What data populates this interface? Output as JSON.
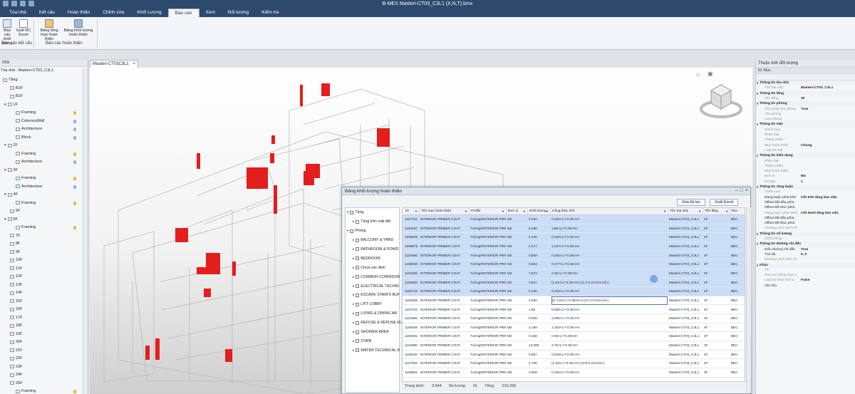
{
  "window": {
    "title": "B-MEX Masteri-CT03_C3L1 (X,N,T).bmx"
  },
  "ribbon_tabs": [
    "Tòa nhà",
    "Kết cấu",
    "Hoàn thiện",
    "Chỉnh sửa",
    "Khối Lượng",
    "Báo cáo",
    "Xem",
    "Đối tượng",
    "Kiểm tra"
  ],
  "ribbon_active": "Báo cáo",
  "ribbon": {
    "btn1": "Báo cáo khối lượng",
    "btn2": "Xuất RC Excel",
    "group1": "Báo cáo kết cấu",
    "btn3": "Bảng tổng hợp hoàn thiện",
    "btn4": "Bảng khối lượng hoàn thiện",
    "group2": "Báo cáo hoàn thiện"
  },
  "left_panel": {
    "header": "nhà",
    "root": "Tòa nhà : Masteri-CT03_C3L1",
    "items": [
      "Tầng",
      "B2F",
      "B1F",
      "1F",
      "Framing",
      "ColumnsWall",
      "Architecture",
      "Block",
      "2F",
      "Framing",
      "Architecture",
      "3F",
      "Framing",
      "Architecture",
      "4F",
      "Framing",
      "5F",
      "6F",
      "Framing",
      "7F",
      "8F",
      "9F",
      "10F",
      "11F",
      "12F",
      "13F",
      "14F",
      "15F",
      "16F",
      "17F",
      "18F",
      "19F",
      "20F",
      "21F",
      "22F",
      "23F",
      "24F",
      "25F",
      "Framing"
    ]
  },
  "view_tab": "Masteri-CT03C3L1",
  "dialog": {
    "title": "Bảng khối lượng hoàn thiện",
    "btn_clear": "Xóa bộ lọc",
    "btn_export": "Xuất Excel",
    "filters": [
      "Tầng",
      "Tầng trên mặt đất",
      "Phòng",
      "BALCONY & YARD",
      "BATHROOM & POWD",
      "BEDROOM",
      "Chưa xác định",
      "COMMON CORRIDOR",
      "ELECTRICAL TECHNI",
      "ESCAPE STAIR'S BUF",
      "LIFT LOBBY",
      "LIVING & DINING AR",
      "REFUSE & REPUSE EL",
      "SHOWER AREA",
      "STAIR",
      "WATER TECHNICAL R"
    ],
    "columns": [
      "ID",
      "Tên mục hoàn thiện",
      "Profile",
      "Đơn vị",
      "Khối lượng",
      "Công thức tính",
      "Tên tòa nhà",
      "Tên tầng",
      "Bec"
    ],
    "rows": [
      [
        "1107721",
        "INTERIOR PRIMER COAT",
        "Tường#INTERIOR PRIMER C",
        "M2",
        "0.342",
        "0.182<L>*3.35<H>",
        "Masteri-CT03_C3L1",
        "4F",
        "BEC"
      ],
      [
        "1103497",
        "INTERIOR PRIMER COAT",
        "Tường#INTERIOR PRIMER C",
        "M2",
        "6.198",
        "1.85<L>*3.35<H>",
        "Masteri-CT03_C3L1",
        "4F",
        "BEC"
      ],
      [
        "1099930",
        "INTERIOR PRIMER COAT",
        "Tường#INTERIOR PRIMER C",
        "M2",
        "0.345",
        "0.183<L>*3.35<H>",
        "Masteri-CT03_C3L1",
        "4F",
        "BEC"
      ],
      [
        "1099875",
        "INTERIOR PRIMER COAT",
        "Tường#INTERIOR PRIMER C",
        "M2",
        "4.177",
        "1.247<L>*3.35<H>",
        "Masteri-CT03_C3L1",
        "4F",
        "BEC"
      ],
      [
        "1102966",
        "INTERIOR PRIMER COAT",
        "Tường#INTERIOR PRIMER C",
        "M2",
        "0.509",
        "0.152<L>*3.35<H>",
        "Masteri-CT03_C3L1",
        "4F",
        "BEC"
      ],
      [
        "1108049",
        "INTERIOR PRIMER COAT",
        "Tường#INTERIOR PRIMER C",
        "M2",
        "0.593",
        "0.177<L>*3.35<H>",
        "Masteri-CT03_C3L1",
        "4F",
        "BEC"
      ],
      [
        "1101506",
        "INTERIOR PRIMER COAT",
        "Tường#INTERIOR PRIMER C",
        "M2",
        "7.873",
        "2.35<L>*3.35<H>",
        "Masteri-CT03_C3L1",
        "4F",
        "BEC"
      ],
      [
        "1106820",
        "INTERIOR PRIMER COAT",
        "Tường#INTERIOR PRIMER C",
        "M2",
        "3.647",
        "(1.81<L>*3.35<H>)-(1.1*2.2<Cửa sổ>)",
        "Masteri-CT03_C3L1",
        "4F",
        "BEC"
      ],
      [
        "1106718",
        "INTERIOR PRIMER COAT",
        "Tường#INTERIOR PRIMER C",
        "M2",
        "0.345",
        "0.183<L>*3.35<H>",
        "Masteri-CT03_C3L1",
        "4F",
        "BEC"
      ],
      [
        "1106208",
        "INTERIOR PRIMER COAT",
        "Tường#INTERIOR PRIMER C",
        "M2",
        "4.692",
        "(2.714<L>*3.35<H>)-(2*2.2<Cửa sổ>)",
        "Masteri-CT03_C3L1",
        "4F",
        "BEC"
      ],
      [
        "1107243",
        "INTERIOR PRIMER COAT",
        "Tường#INTERIOR PRIMER C",
        "M2",
        "1.96",
        "0.585<L>*3.35<H>",
        "Masteri-CT03_C3L1",
        "4F",
        "BEC"
      ],
      [
        "1111968",
        "INTERIOR PRIMER COAT",
        "Tường#INTERIOR PRIMER C",
        "M2",
        "9.028",
        "2.695<L>*3.35<H>",
        "Masteri-CT03_C3L1",
        "4F",
        "BEC"
      ],
      [
        "1106459",
        "INTERIOR PRIMER COAT",
        "Tường#INTERIOR PRIMER C",
        "M2",
        "4.199",
        "1.253<L>*3.35<H>",
        "Masteri-CT03_C3L1",
        "4F",
        "BEC"
      ],
      [
        "1102031",
        "INTERIOR PRIMER COAT",
        "Tường#INTERIOR PRIMER C",
        "M2",
        "0.168",
        "0.05<L>*3.35<H>",
        "Masteri-CT03_C3L1",
        "4F",
        "BEC"
      ],
      [
        "1102690",
        "INTERIOR PRIMER COAT",
        "Tường#INTERIOR PRIMER C",
        "M2",
        "12.596",
        "3.76<L>*3.35<H>",
        "Masteri-CT03_C3L1",
        "4F",
        "BEC"
      ],
      [
        "1106220",
        "INTERIOR PRIMER COAT",
        "Tường#INTERIOR PRIMER C",
        "M2",
        "0.697",
        "0.208<L>*3.35<H>",
        "Masteri-CT03_C3L1",
        "4F",
        "BEC"
      ],
      [
        "1107262",
        "INTERIOR PRIMER COAT",
        "Tường#INTERIOR PRIMER C",
        "M2",
        "4.706",
        "(1.93<L>*3.35<H>)-(0.8*2.2<Cửa>)",
        "Masteri-CT03_C3L1",
        "4F",
        "BEC"
      ],
      [
        "1106501",
        "INTERIOR PRIMER COAT",
        "Tường#INTERIOR PRIMER C",
        "M2",
        "0.509",
        "0.152<L>*3.35<H>",
        "Masteri-CT03_C3L1",
        "4F",
        "BEC"
      ]
    ],
    "footer": {
      "avg_label": "Trung bình:",
      "avg": "3.544",
      "count_label": "Số lượng:",
      "count": "61",
      "total_label": "Tổng:",
      "total": "216.206"
    }
  },
  "right_panel": {
    "header": "Thuộc tính đối tượng",
    "sub": "61 Mục",
    "props": [
      [
        "cat",
        "Thông tin tòa nhà",
        ""
      ],
      [
        "row",
        "Tên tòa nhà",
        "Masteri-CT03_C3L1"
      ],
      [
        "cat",
        "Thông tin tầng",
        ""
      ],
      [
        "row",
        "Tên tầng",
        "4F"
      ],
      [
        "cat",
        "Thông tin phòng",
        ""
      ],
      [
        "row",
        "Cho phép tìm phòng",
        "True"
      ],
      [
        "row",
        "Tên phòng",
        ""
      ],
      [
        "row",
        "Loại phòng",
        ""
      ],
      [
        "cat",
        "Thông tin mặt",
        ""
      ],
      [
        "row",
        "Danh mục",
        ""
      ],
      [
        "row",
        "Phân loại",
        ""
      ],
      [
        "row",
        "Thành phần",
        ""
      ],
      [
        "row",
        "Mục hoàn thiện",
        "Chung"
      ],
      [
        "row",
        "Loại bề mặt",
        ""
      ],
      [
        "cat",
        "Thông tin biên dạng",
        ""
      ],
      [
        "row",
        "Phân loại",
        ""
      ],
      [
        "row",
        "Thành phần",
        ""
      ],
      [
        "row",
        "Mục hoàn thiện",
        ""
      ],
      [
        "row",
        "Đơn vị",
        "M2"
      ],
      [
        "row",
        "Độ dày",
        "1"
      ],
      [
        "cat",
        "Thông tin ràng buộc",
        ""
      ],
      [
        "row",
        "Chiều cao",
        ""
      ],
      [
        "drow",
        "Ràng buộc phía trên",
        "Cốt trên tầng làm việc"
      ],
      [
        "drow",
        "Offset bắt đầu phía",
        ""
      ],
      [
        "drow",
        "Offset kết thúc phía",
        ""
      ],
      [
        "row",
        "Ràng buộc phía dưới",
        "Cốt dưới tầng làm việc"
      ],
      [
        "drow",
        "Offset bắt đầu phía",
        ""
      ],
      [
        "drow",
        "Offset kết thúc phía",
        ""
      ],
      [
        "row",
        "Khoảng cách dưới lớ",
        ""
      ],
      [
        "cat",
        "Thông tin số lượng",
        ""
      ],
      [
        "row",
        "Khối lượng",
        ""
      ],
      [
        "cat",
        "Thông tin đường chỉ dẫn",
        ""
      ],
      [
        "drow",
        "Kiểu đường chỉ dẫn",
        "True"
      ],
      [
        "drow",
        "Tỏa độ",
        "0, 0"
      ],
      [
        "row",
        "Khoảng cách chữ (T)",
        ""
      ],
      [
        "cat",
        "Khác",
        ""
      ],
      [
        "row",
        "Tô",
        ""
      ],
      [
        "row",
        "Khu vực hàng mục II",
        ""
      ],
      [
        "row",
        "Loại trừ khỏi tính to",
        "False"
      ],
      [
        "drow",
        "Ghi chú",
        ""
      ]
    ]
  },
  "colors": {
    "titlebar": "#2d4a6e",
    "accent_red": "#e41d1d",
    "selection": "#c9ddf7"
  }
}
